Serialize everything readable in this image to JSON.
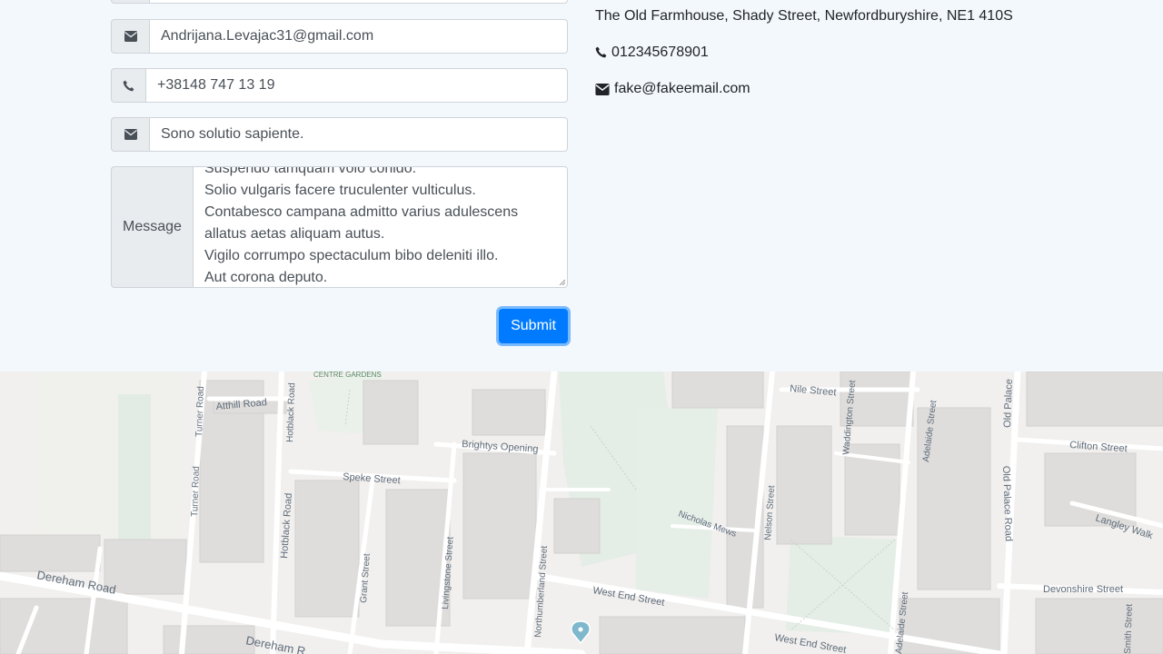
{
  "form": {
    "hidden_field_value": "",
    "email_value": "Andrijana.Levajac31@gmail.com",
    "phone_value": "+38148 747 13 19",
    "subject_value": "Sono solutio sapiente.",
    "message_label": "Message",
    "message_lines": [
      "Suspendo tamquam volo conido.",
      "Solio vulgaris facere truculenter vulticulus.",
      "Contabesco campana admitto varius adulescens",
      "allatus aetas aliquam autus.",
      "Vigilo corrumpo spectaculum bibo deleniti illo.",
      "Aut corona deputo."
    ],
    "submit_label": "Submit"
  },
  "contact": {
    "address": "The Old Farmhouse, Shady Street, Newfordburyshire, NE1 410S",
    "phone": "012345678901",
    "email": "fake@fakeemail.com"
  },
  "map": {
    "labels": {
      "centre_gardens": "CENTRE GARDENS",
      "atthill_road": "Atthill Road",
      "turner_road": "Turner Road",
      "hotblack_road_top": "Hotblack Road",
      "hotblack_road": "Hotblack Road",
      "brightys_opening": "Brightys Opening",
      "speke_street": "Speke Street",
      "nile_street": "Nile Street",
      "waddington_street": "Waddington Street",
      "adelaide_street_top": "Adelaide Street",
      "old_palace_road_top": "Old Palace",
      "old_palace_road": "Old Palace Road",
      "clifton_street": "Clifton Street",
      "langley_walk": "Langley Walk",
      "nicholas_mews": "Nicholas Mews",
      "nelson_street": "Nelson Street",
      "turner_road_lower": "Turner Road",
      "grant_street": "Grant Street",
      "livingstone_street": "Livingstone Street",
      "northumberland_street": "Northumberland Street",
      "dereham_road": "Dereham Road",
      "dereham_road_lower": "Dereham R",
      "west_end_street": "West End Street",
      "west_end_street_lower": "West End Street",
      "adelaide_street": "Adelaide Street",
      "devonshire_street": "Devonshire Street",
      "smith_street": "Smith Street"
    },
    "pin_color": "#7fb8cc"
  },
  "colors": {
    "accent": "#007bff",
    "page_bg": "#f3f8fd",
    "map_bg": "#f1f0ee"
  }
}
